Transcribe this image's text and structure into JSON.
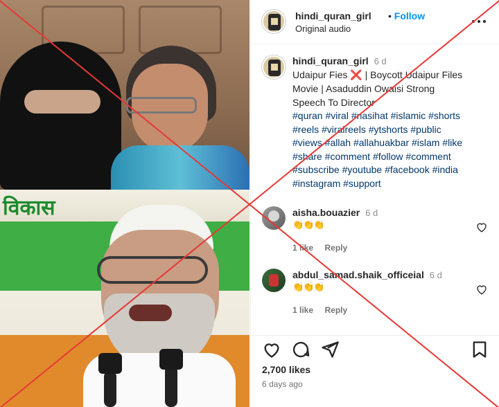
{
  "header": {
    "username": "hindi_quran_girl",
    "follow_label": "Follow",
    "audio": "Original audio",
    "more_icon": "more-horizontal-icon"
  },
  "media": {
    "banner_text": "विकास"
  },
  "caption": {
    "username": "hindi_quran_girl",
    "time": "6 d",
    "line1_a": "Udaipur Fies",
    "cross_emoji": "❌",
    "line1_b": "| Boycott Udaipur Files",
    "line2": "Movie | Asaduddin Owaisi Strong",
    "line3": "Speech To Director",
    "hashtags": [
      "#quran #viral #nasihat #islamic #shorts",
      "#reels #viralreels #ytshorts #public",
      "#views #allah #allahuakbar #islam #like",
      "#share #comment #follow #comment",
      "#subscribe #youtube #facebook #india",
      "#instagram #support"
    ]
  },
  "comments": [
    {
      "username": "aisha.bouazier",
      "time": "6 d",
      "text": "👏👏👏",
      "likes": "1 like",
      "reply": "Reply"
    },
    {
      "username": "abdul_samad.shaik_officeial",
      "time": "6 d",
      "text": "👏👏👏",
      "likes": "1 like",
      "reply": "Reply"
    }
  ],
  "footer": {
    "likes": "2,700 likes",
    "age": "6 days ago"
  },
  "colors": {
    "accent": "#0095f6",
    "link": "#00376b",
    "cross_overlay": "#e53935"
  }
}
